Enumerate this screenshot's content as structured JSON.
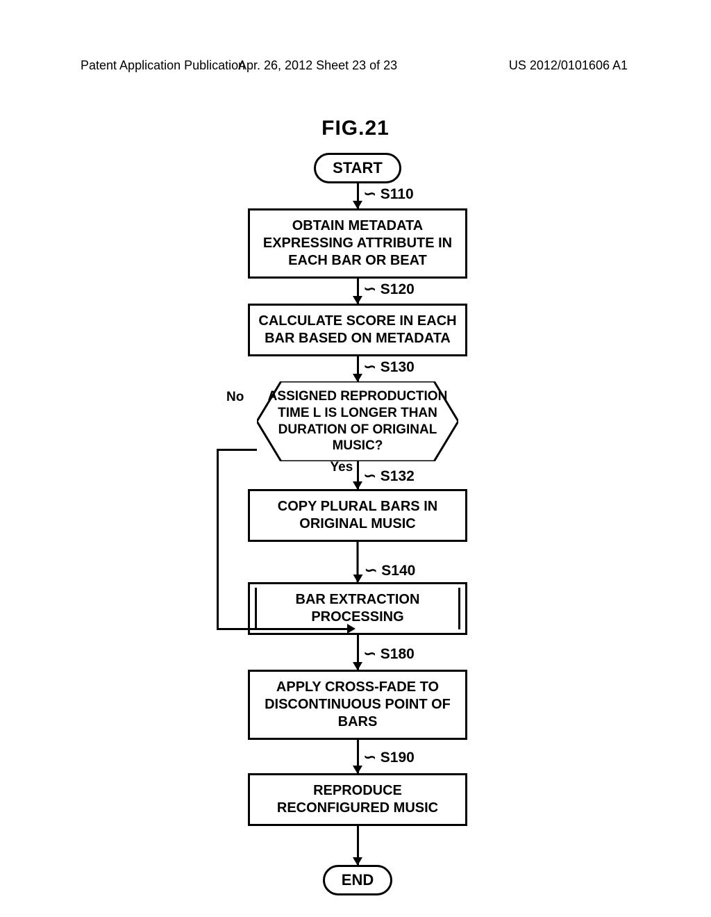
{
  "header": {
    "left": "Patent Application Publication",
    "mid": "Apr. 26, 2012  Sheet 23 of 23",
    "right": "US 2012/0101606 A1"
  },
  "fig_title": "FIG.21",
  "steps": {
    "start": "START",
    "s110": "OBTAIN METADATA EXPRESSING ATTRIBUTE IN EACH BAR OR BEAT",
    "s120": "CALCULATE SCORE IN EACH BAR BASED ON METADATA",
    "s130": "ASSIGNED REPRODUCTION TIME L IS LONGER THAN DURATION OF ORIGINAL MUSIC?",
    "s132": "COPY PLURAL BARS IN ORIGINAL MUSIC",
    "s140": "BAR EXTRACTION PROCESSING",
    "s180": "APPLY CROSS-FADE TO DISCONTINUOUS POINT OF BARS",
    "s190": "REPRODUCE RECONFIGURED MUSIC",
    "end": "END"
  },
  "labels": {
    "s110": "S110",
    "s120": "S120",
    "s130": "S130",
    "s132": "S132",
    "s140": "S140",
    "s180": "S180",
    "s190": "S190",
    "no": "No",
    "yes": "Yes"
  }
}
